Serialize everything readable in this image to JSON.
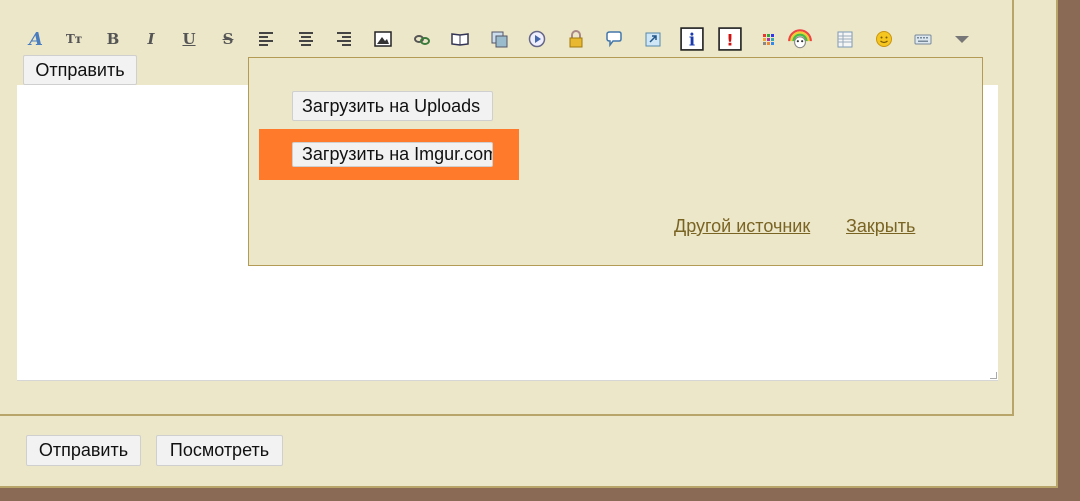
{
  "toolbar": {
    "icons": [
      "font-color-icon",
      "font-size-icon",
      "bold-icon",
      "italic-icon",
      "underline-icon",
      "strikethrough-icon",
      "align-left-icon",
      "align-center-icon",
      "align-right-icon",
      "image-icon",
      "link-icon",
      "book-icon",
      "copy-icon",
      "video-icon",
      "lock-icon",
      "speech-bubble-icon",
      "share-icon",
      "info-icon",
      "warning-icon",
      "color-grid-icon",
      "rainbow-icon",
      "table-icon",
      "smiley-icon",
      "keyboard-icon",
      "more-arrow-icon"
    ],
    "bold": "B",
    "italic": "I",
    "underline": "U",
    "strike": "S",
    "font_size": "Tт"
  },
  "editor": {
    "send_label": "Отправить"
  },
  "popup": {
    "upload_uploads_label": "Загрузить на Uploads",
    "upload_imgur_label": "Загрузить на Imgur.com",
    "other_source_label": "Другой источник",
    "close_label": "Закрыть",
    "highlight_color": "#ff7a2a"
  },
  "footer": {
    "send_label": "Отправить",
    "preview_label": "Посмотреть"
  }
}
